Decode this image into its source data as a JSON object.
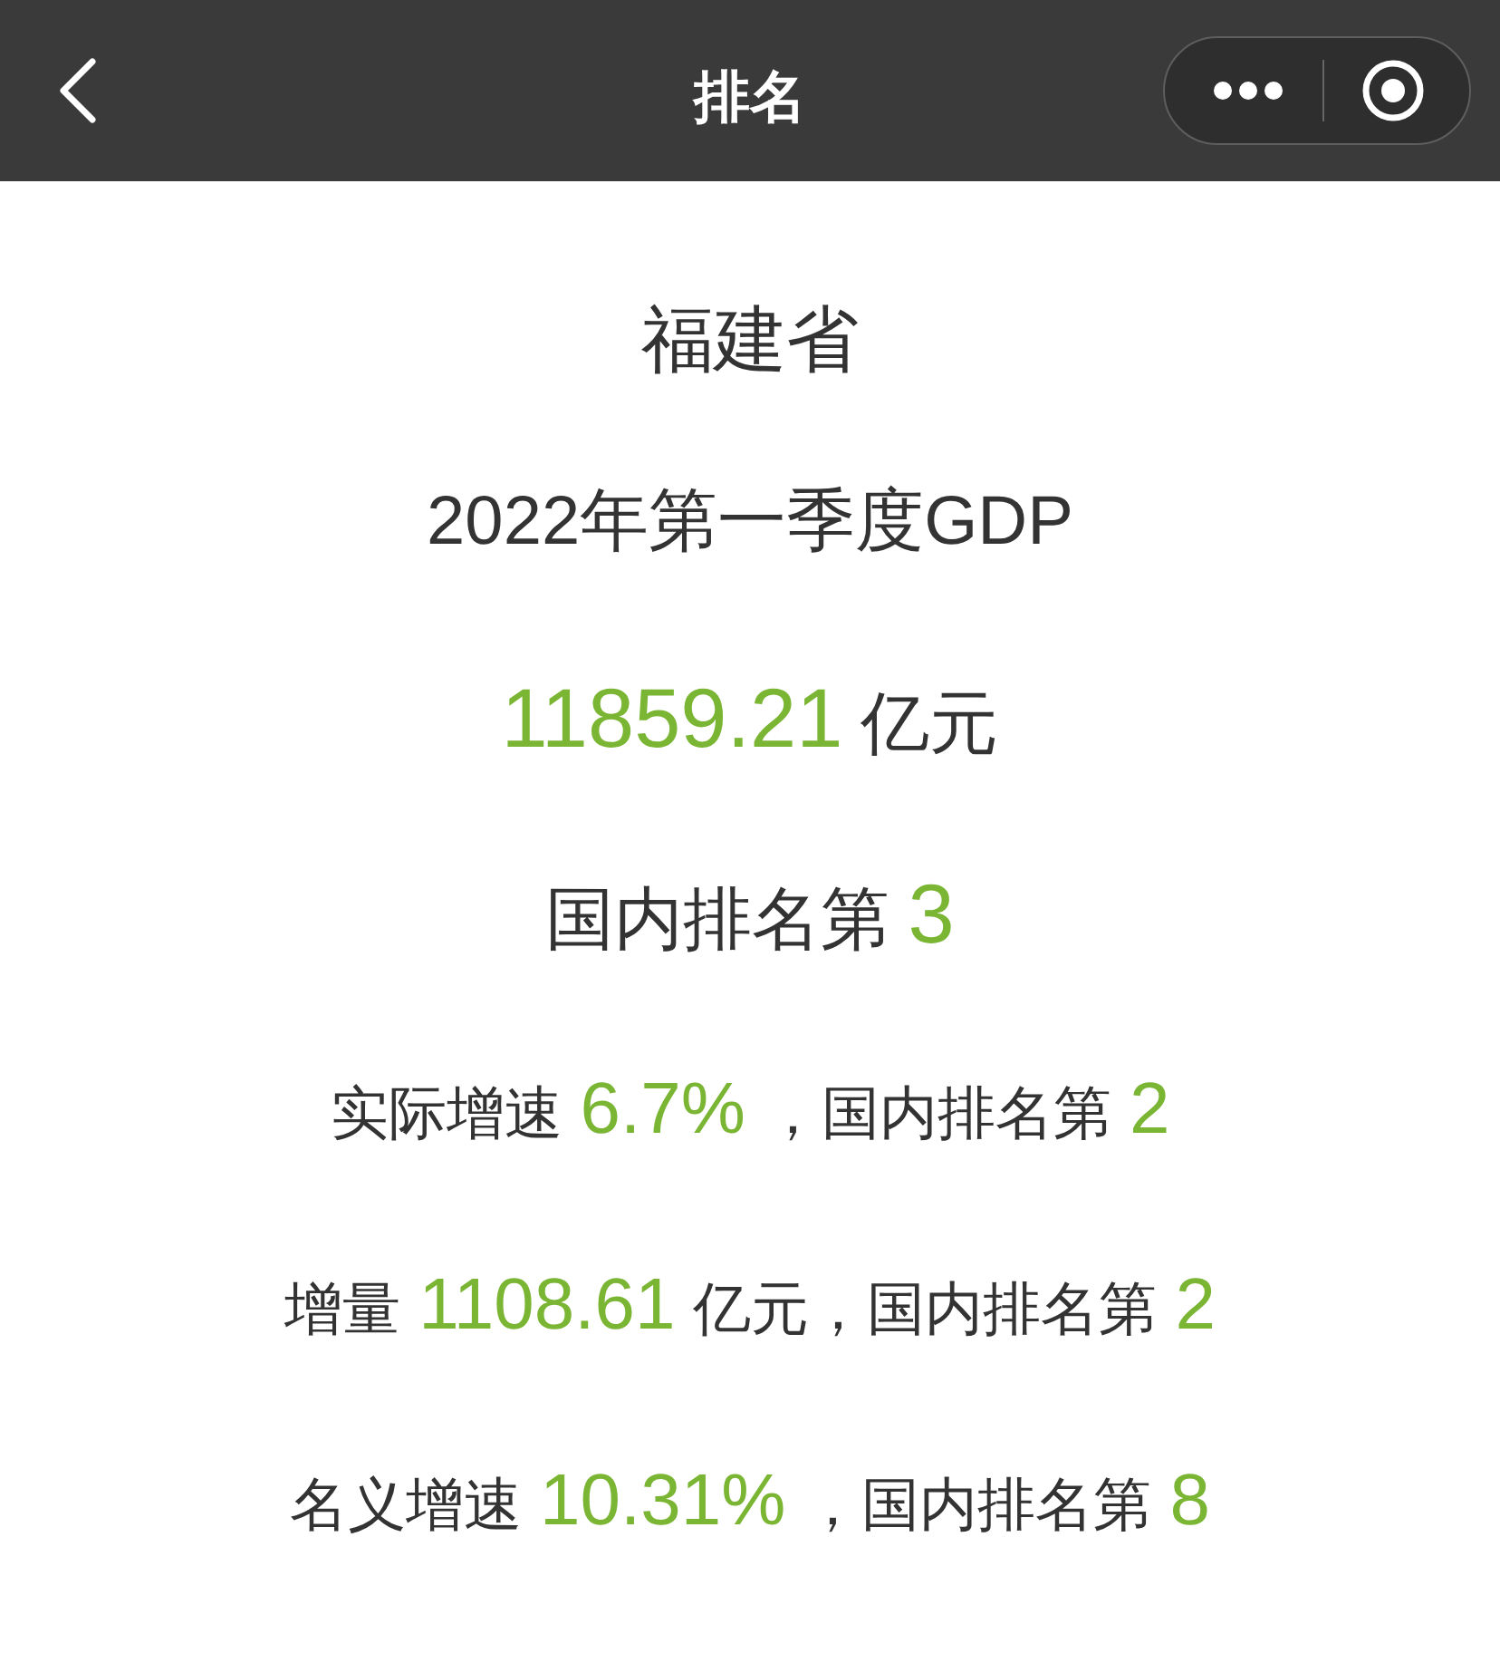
{
  "nav_bar": {
    "title": "排名"
  },
  "lines": [
    {
      "parts": [
        {
          "text": "福建省",
          "kind": "plain"
        }
      ]
    },
    {
      "parts": [
        {
          "text": "2022年第一季度GDP",
          "kind": "plain"
        }
      ]
    },
    {
      "parts": [
        {
          "text": "11859.21",
          "kind": "value"
        },
        {
          "text": "亿元",
          "kind": "plain"
        }
      ]
    },
    {
      "parts": [
        {
          "text": "国内排名第",
          "kind": "plain"
        },
        {
          "text": "3",
          "kind": "value"
        }
      ]
    },
    {
      "parts": [
        {
          "text": "实际增速",
          "kind": "plain"
        },
        {
          "text": "6.7%",
          "kind": "value"
        },
        {
          "text": "，国内排名第",
          "kind": "plain"
        },
        {
          "text": "2",
          "kind": "value"
        }
      ]
    },
    {
      "parts": [
        {
          "text": "增量",
          "kind": "plain"
        },
        {
          "text": "1108.61",
          "kind": "value"
        },
        {
          "text": "亿元，国内排名第",
          "kind": "plain"
        },
        {
          "text": "2",
          "kind": "value"
        }
      ]
    },
    {
      "parts": [
        {
          "text": "名义增速",
          "kind": "plain"
        },
        {
          "text": "10.31%",
          "kind": "value"
        },
        {
          "text": "，国内排名第",
          "kind": "plain"
        },
        {
          "text": "8",
          "kind": "value"
        }
      ]
    }
  ]
}
